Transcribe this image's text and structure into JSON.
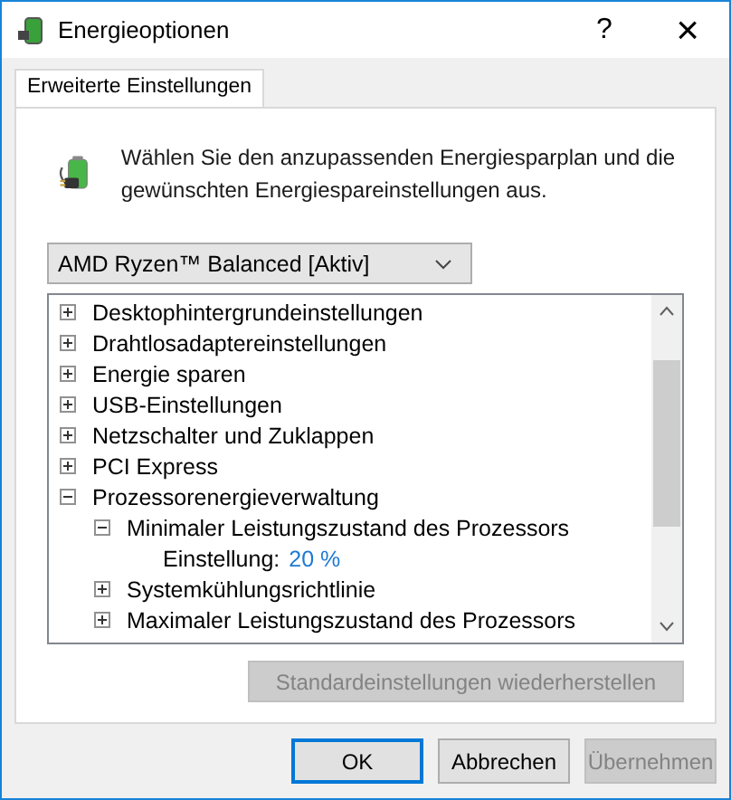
{
  "window": {
    "title": "Energieoptionen",
    "help": "?",
    "close": "×"
  },
  "tabs": [
    {
      "label": "Erweiterte Einstellungen",
      "selected": true
    }
  ],
  "intro": "Wählen Sie den anzupassenden Energiesparplan und die gewünschten Energiespareinstellungen aus.",
  "plan_dropdown": {
    "value": "AMD Ryzen™ Balanced [Aktiv]"
  },
  "tree": [
    {
      "kind": "node",
      "label": "Desktophintergrundeinstellungen",
      "expanded": false
    },
    {
      "kind": "node",
      "label": "Drahtlosadaptereinstellungen",
      "expanded": false
    },
    {
      "kind": "node",
      "label": "Energie sparen",
      "expanded": false
    },
    {
      "kind": "node",
      "label": "USB-Einstellungen",
      "expanded": false
    },
    {
      "kind": "node",
      "label": "Netzschalter und Zuklappen",
      "expanded": false
    },
    {
      "kind": "node",
      "label": "PCI Express",
      "expanded": false
    },
    {
      "kind": "node",
      "label": "Prozessorenergieverwaltung",
      "expanded": true,
      "children": [
        {
          "kind": "node",
          "label": "Minimaler Leistungszustand des Prozessors",
          "expanded": true,
          "children": [
            {
              "kind": "setting",
              "label": "Einstellung:",
              "value": "20 %"
            }
          ]
        },
        {
          "kind": "node",
          "label": "Systemkühlungsrichtlinie",
          "expanded": false
        },
        {
          "kind": "node",
          "label": "Maximaler Leistungszustand des Prozessors",
          "expanded": false
        }
      ]
    }
  ],
  "restore_button": {
    "label": "Standardeinstellungen wiederherstellen",
    "disabled": true
  },
  "buttons": [
    {
      "label": "OK",
      "disabled": false,
      "focused": true
    },
    {
      "label": "Abbrechen",
      "disabled": false,
      "focused": false
    },
    {
      "label": "Übernehmen",
      "disabled": true,
      "focused": false
    }
  ]
}
